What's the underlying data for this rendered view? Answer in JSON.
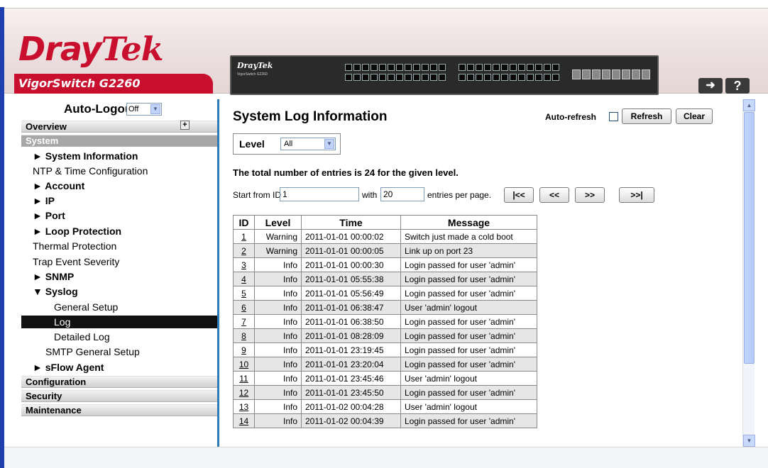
{
  "header": {
    "brand_dray": "Dray",
    "brand_tek": "Tek",
    "model": "VigorSwitch G2260",
    "panel_brand": "DrayTek",
    "panel_sub": "VigorSwitch G2260",
    "logout_icon": "logout-arrow-icon",
    "help_label": "?"
  },
  "sidebar": {
    "autologout_label": "Auto-Logout",
    "autologout_value": "Off",
    "sections": {
      "overview": "Overview",
      "system": "System",
      "configuration": "Configuration",
      "security": "Security",
      "maintenance": "Maintenance"
    },
    "items": {
      "system_information": "► System Information",
      "ntp": "NTP & Time Configuration",
      "account": "► Account",
      "ip": "► IP",
      "port": "► Port",
      "loop_protection": "► Loop Protection",
      "thermal": "Thermal Protection",
      "trap": "Trap Event Severity",
      "snmp": "► SNMP",
      "syslog": "▼ Syslog",
      "general_setup": "General Setup",
      "log": "Log",
      "detailed_log": "Detailed Log",
      "smtp": "SMTP General Setup",
      "sflow": "► sFlow Agent"
    }
  },
  "main": {
    "title": "System Log Information",
    "autorefresh_label": "Auto-refresh",
    "refresh_label": "Refresh",
    "clear_label": "Clear",
    "level_label": "Level",
    "level_value": "All",
    "total_text": "The total number of entries is 24 for the given level.",
    "start_from_label": "Start from ID",
    "start_from_value": "1",
    "with_label": "with",
    "with_value": "20",
    "per_page_label": "entries per page.",
    "nav_first": "|<<",
    "nav_prev": "<<",
    "nav_next": ">>",
    "nav_last": ">>|",
    "table": {
      "headers": [
        "ID",
        "Level",
        "Time",
        "Message"
      ],
      "rows": [
        {
          "id": "1",
          "level": "Warning",
          "time": "2011-01-01 00:00:02",
          "message": "Switch just made a cold boot"
        },
        {
          "id": "2",
          "level": "Warning",
          "time": "2011-01-01 00:00:05",
          "message": "Link up on port 23"
        },
        {
          "id": "3",
          "level": "Info",
          "time": "2011-01-01 00:00:30",
          "message": "Login passed for user 'admin'"
        },
        {
          "id": "4",
          "level": "Info",
          "time": "2011-01-01 05:55:38",
          "message": "Login passed for user 'admin'"
        },
        {
          "id": "5",
          "level": "Info",
          "time": "2011-01-01 05:56:49",
          "message": "Login passed for user 'admin'"
        },
        {
          "id": "6",
          "level": "Info",
          "time": "2011-01-01 06:38:47",
          "message": "User 'admin' logout"
        },
        {
          "id": "7",
          "level": "Info",
          "time": "2011-01-01 06:38:50",
          "message": "Login passed for user 'admin'"
        },
        {
          "id": "8",
          "level": "Info",
          "time": "2011-01-01 08:28:09",
          "message": "Login passed for user 'admin'"
        },
        {
          "id": "9",
          "level": "Info",
          "time": "2011-01-01 23:19:45",
          "message": "Login passed for user 'admin'"
        },
        {
          "id": "10",
          "level": "Info",
          "time": "2011-01-01 23:20:04",
          "message": "Login passed for user 'admin'"
        },
        {
          "id": "11",
          "level": "Info",
          "time": "2011-01-01 23:45:46",
          "message": "User 'admin' logout"
        },
        {
          "id": "12",
          "level": "Info",
          "time": "2011-01-01 23:45:50",
          "message": "Login passed for user 'admin'"
        },
        {
          "id": "13",
          "level": "Info",
          "time": "2011-01-02 00:04:28",
          "message": "User 'admin' logout"
        },
        {
          "id": "14",
          "level": "Info",
          "time": "2011-01-02 00:04:39",
          "message": "Login passed for user 'admin'"
        }
      ]
    }
  },
  "colors": {
    "brand_red": "#c8102e",
    "frame_blue": "#1f3fae",
    "divider_blue": "#2f7ab8",
    "active_item_bg": "#111111"
  }
}
